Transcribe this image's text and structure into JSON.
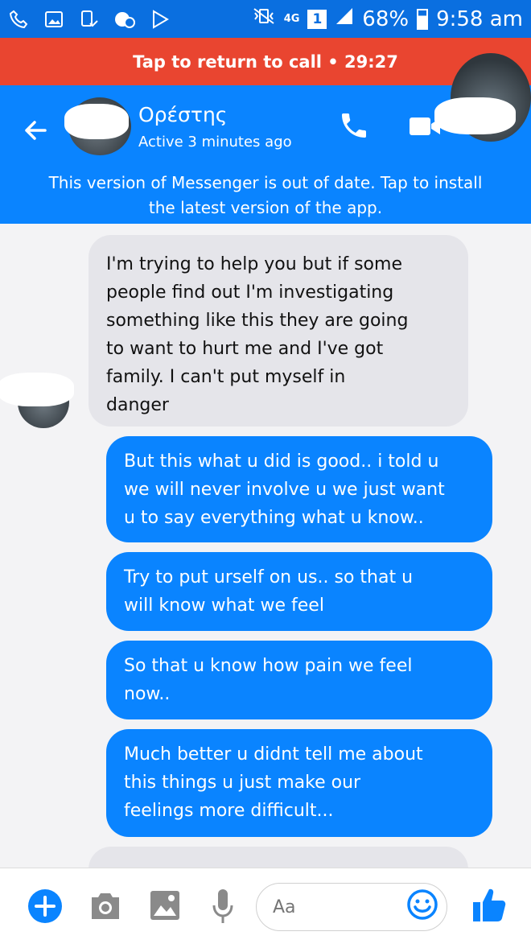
{
  "status_bar": {
    "network": "4G",
    "sim": "1",
    "battery": "68%",
    "time": "9:58 am"
  },
  "call_bar": {
    "label": "Tap to return to call • 29:27"
  },
  "header": {
    "name": "Ορέστης",
    "status": "Active 3 minutes ago",
    "outdated_notice_line1": "This version of Messenger is out of date. Tap to install",
    "outdated_notice_line2": "the latest version of the app."
  },
  "messages": [
    {
      "direction": "in",
      "lines": [
        "I'm trying to help you but if some",
        "people find out I'm investigating",
        "something like this they are going",
        "to want to hurt me and I've got",
        "family. I can't put myself in",
        "danger"
      ]
    },
    {
      "direction": "out",
      "lines": [
        "But this what u did is good.. i told u",
        "we will never involve u we just want",
        "u to say everything what u know.."
      ]
    },
    {
      "direction": "out",
      "lines": [
        "Try to put urself on us.. so that u",
        "will know what we feel"
      ]
    },
    {
      "direction": "out",
      "lines": [
        "So that u know how pain we feel",
        "now.."
      ]
    },
    {
      "direction": "out",
      "lines": [
        "Much better u didnt tell me about",
        "this things u just make our",
        "feelings more difficult..."
      ]
    }
  ],
  "composer": {
    "placeholder": "Aa"
  },
  "colors": {
    "messenger_blue": "#0a84ff",
    "status_bar_blue": "#0a6fe0",
    "call_red": "#e94530",
    "incoming_bubble": "#e5e5ea"
  }
}
